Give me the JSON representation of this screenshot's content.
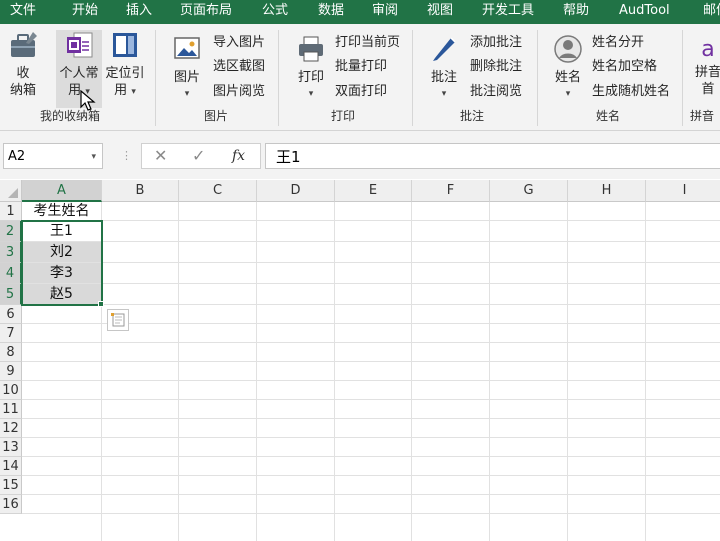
{
  "tabs": [
    "文件",
    "开始",
    "插入",
    "页面布局",
    "公式",
    "数据",
    "审阅",
    "视图",
    "开发工具",
    "帮助",
    "AudTool",
    "邮件"
  ],
  "ribbon": {
    "box": {
      "btn1_line1": "收",
      "btn1_line2": "纳箱",
      "btn2_line1": "个人常",
      "btn2_line2": "用",
      "btn3_line1": "定位引",
      "btn3_line2": "用",
      "label": "我的收纳箱"
    },
    "picture": {
      "main": "图片",
      "item1": "导入图片",
      "item2": "选区截图",
      "item3": "图片阅览",
      "label": "图片"
    },
    "print": {
      "main": "打印",
      "item1": "打印当前页",
      "item2": "批量打印",
      "item3": "双面打印",
      "label": "打印"
    },
    "comment": {
      "main": "批注",
      "item1": "添加批注",
      "item2": "删除批注",
      "item3": "批注阅览",
      "label": "批注"
    },
    "name": {
      "main": "姓名",
      "item1": "姓名分开",
      "item2": "姓名加空格",
      "item3": "生成随机姓名",
      "label": "姓名"
    },
    "pinyin": {
      "main": "拼音",
      "main2": "首",
      "label": "拼音"
    },
    "caret": "▾",
    "colors": {
      "accent": "#217346",
      "tab_bar": "#217346",
      "selection_fill": "#d9d9d9",
      "icon_blue": "#2b579a",
      "icon_purple": "#7030a0"
    }
  },
  "formula_bar": {
    "name_box": "A2",
    "cancel": "✕",
    "confirm": "✓",
    "fx": "fx",
    "content": "王1"
  },
  "sheet": {
    "columns": [
      "A",
      "B",
      "C",
      "D",
      "E",
      "F",
      "G",
      "H",
      "I"
    ],
    "rows": [
      "1",
      "2",
      "3",
      "4",
      "5",
      "6",
      "7",
      "8",
      "9",
      "10",
      "11",
      "12",
      "13",
      "14",
      "15",
      "16"
    ],
    "cells": [
      {
        "ref": "A1",
        "value": "考生姓名"
      },
      {
        "ref": "A2",
        "value": "王1"
      },
      {
        "ref": "A3",
        "value": "刘2"
      },
      {
        "ref": "A4",
        "value": "李3"
      },
      {
        "ref": "A5",
        "value": "赵5"
      }
    ],
    "selection": "A2:A5",
    "quick_analysis_icon": "quick-analysis-icon"
  }
}
